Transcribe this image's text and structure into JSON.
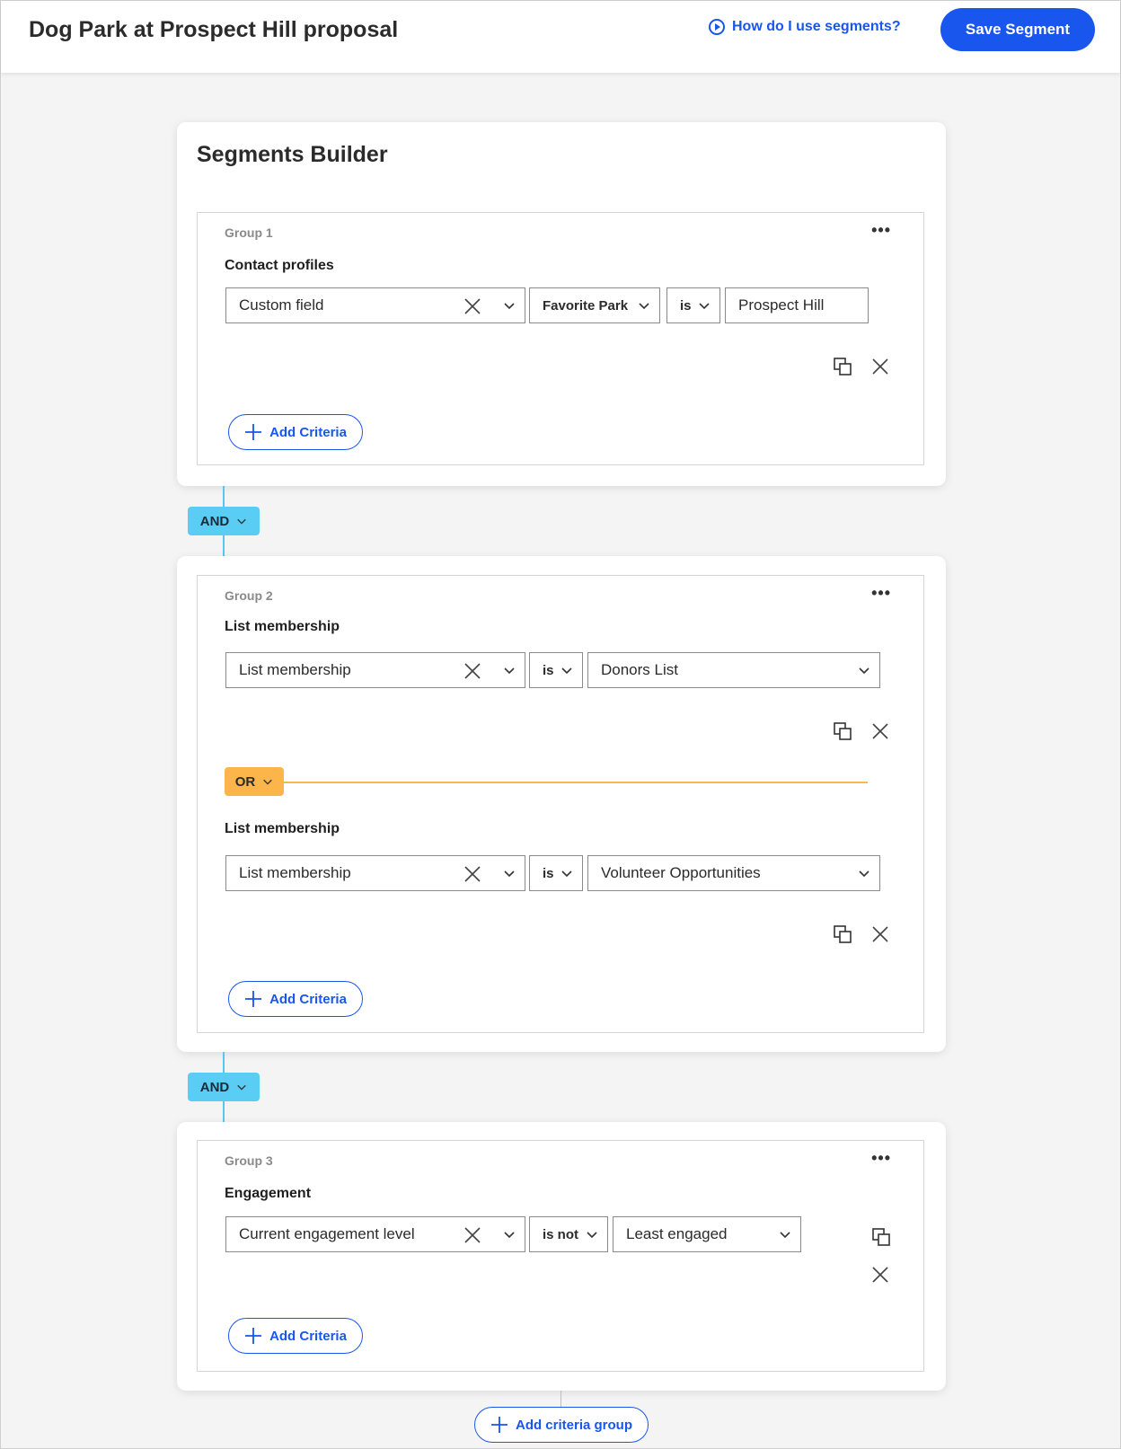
{
  "header": {
    "title": "Dog Park at Prospect Hill proposal",
    "help_link": "How do I use segments?",
    "save_label": "Save Segment"
  },
  "builder": {
    "title": "Segments Builder",
    "add_criteria_label": "Add Criteria",
    "add_group_label": "Add criteria group",
    "and_label": "AND",
    "or_label": "OR"
  },
  "groups": [
    {
      "label": "Group 1",
      "criteria": [
        {
          "title": "Contact profiles",
          "field": "Custom field",
          "subfield": "Favorite Park",
          "operator": "is",
          "value": "Prospect Hill"
        }
      ]
    },
    {
      "label": "Group 2",
      "criteria": [
        {
          "title": "List membership",
          "field": "List membership",
          "operator": "is",
          "value": "Donors List"
        },
        {
          "title": "List membership",
          "field": "List membership",
          "operator": "is",
          "value": "Volunteer Opportunities"
        }
      ]
    },
    {
      "label": "Group 3",
      "criteria": [
        {
          "title": "Engagement",
          "field": "Current engagement level",
          "operator": "is not",
          "value": "Least engaged"
        }
      ]
    }
  ],
  "colors": {
    "primary": "#1856ed",
    "and_badge": "#5acdf5",
    "or_badge": "#fbb54a"
  }
}
